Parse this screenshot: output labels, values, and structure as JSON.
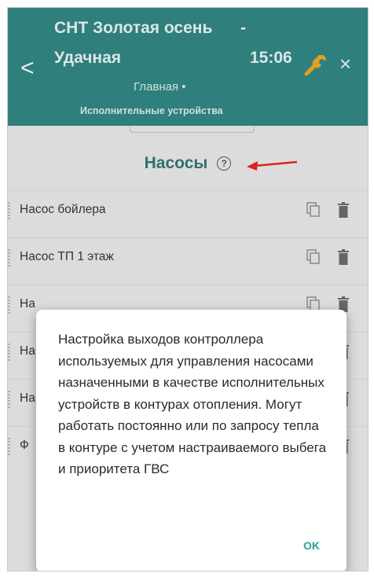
{
  "header": {
    "title_line1": "СНТ Золотая осень",
    "title_dash": "-",
    "title_line2": "Удачная",
    "time": "15:06",
    "breadcrumb_main": "Главная •",
    "breadcrumb_sub": "Исполнительные устройства",
    "back_glyph": "<",
    "close_glyph": "×",
    "accent_color": "#2f7f7c"
  },
  "section": {
    "title": "Насосы",
    "help_glyph": "?"
  },
  "rows": [
    {
      "label": "Насос бойлера"
    },
    {
      "label": "Насос ТП 1 этаж"
    },
    {
      "label": "На"
    },
    {
      "label": "На"
    },
    {
      "label": "На"
    },
    {
      "label": "Ф"
    }
  ],
  "dialog": {
    "text": "Настройка выходов контроллера используемых для управления насосами назначенными в качестве исполнительных устройств в контурах отопления. Могут работать постоянно или по запросу тепла в контуре с учетом настраиваемого выбега и приоритета ГВС",
    "ok_label": "OK"
  }
}
